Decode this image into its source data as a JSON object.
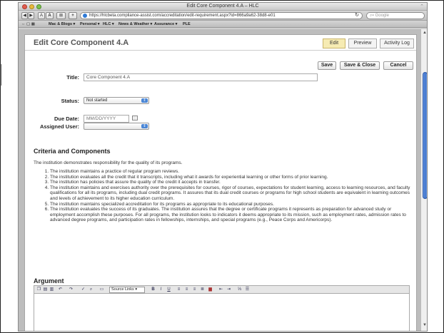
{
  "window": {
    "title": "Edit Core Component 4.A – HLC"
  },
  "browser": {
    "url": "https://hlcbeta.compliance-assist.com/accreditation/edit-requirement.aspx?id=866a9a62-38d8-e01",
    "search_placeholder": "Google",
    "reload_icon": "reload-icon",
    "bookmarks": [
      "Mac & Blogs ▾",
      "Personal ▾",
      "HLC ▾",
      "News & Weather ▾",
      "Assurance ▾",
      "PLE"
    ]
  },
  "page": {
    "title": "Edit Core Component 4.A",
    "tabs": [
      {
        "label": "Edit"
      },
      {
        "label": "Preview"
      },
      {
        "label": "Activity Log"
      }
    ],
    "actions": {
      "save": "Save",
      "save_close": "Save & Close",
      "cancel": "Cancel"
    },
    "form": {
      "title_label": "Title:",
      "title_value": "Core Component 4.A",
      "status_label": "Status:",
      "status_value": "Not started",
      "due_date_label": "Due Date:",
      "due_date_placeholder": "MM/DD/YYYY",
      "assigned_user_label": "Assigned User:",
      "assigned_user_value": ""
    },
    "criteria": {
      "heading": "Criteria and Components",
      "intro": "The institution demonstrates responsibility for the quality of its programs.",
      "items": [
        "The institution maintains a practice of regular program reviews.",
        "The institution evaluates all the credit that it transcripts, including what it awards for experiential learning or other forms of prior learning.",
        "The institution has policies that assure the quality of the credit it accepts in transfer.",
        "The institution maintains and exercises authority over the prerequisites for courses, rigor of courses, expectations for student learning, access to learning resources, and faculty qualifications for all its programs, including dual credit programs. It assures that its dual credit courses or programs for high school students are equivalent in learning outcomes and levels of achievement to its higher education curriculum.",
        "The institution maintains specialized accreditation for its programs as appropriate to its educational purposes.",
        "The institution evaluates the success of its graduates. The institution assures that the degree or certificate programs it represents as preparation for advanced study or employment accomplish these purposes. For all programs, the institution looks to indicators it deems appropriate to its mission, such as employment rates, admission rates to advanced degree programs, and participation rates in fellowships, internships, and special programs (e.g., Peace Corps and Americorps)."
      ]
    },
    "argument": {
      "heading": "Argument",
      "source_links_label": "Source Links"
    }
  }
}
